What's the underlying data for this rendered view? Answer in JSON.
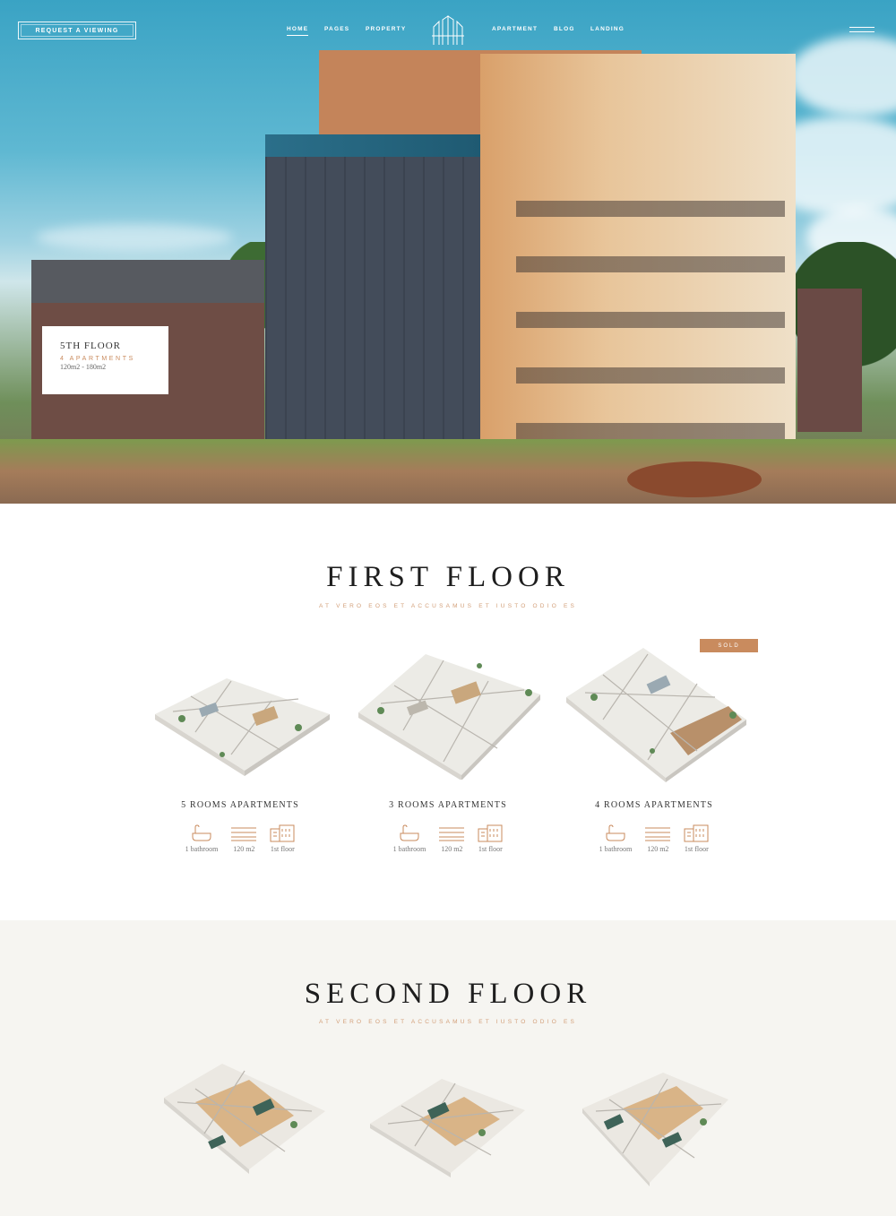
{
  "nav": {
    "cta_label": "REQUEST A VIEWING",
    "menu_items": [
      "HOME",
      "PAGES",
      "PROPERTY",
      "APARTMENT",
      "BLOG",
      "LANDING"
    ],
    "active_item": "HOME"
  },
  "hero": {
    "floor_card": {
      "title": "5TH FLOOR",
      "subtitle": "4 APARTMENTS",
      "meta": "120m2 - 180m2"
    }
  },
  "first_floor": {
    "title": "FIRST FLOOR",
    "subtitle": "AT VERO EOS ET ACCUSAMUS ET IUSTO ODIO ES",
    "apartments": [
      {
        "title": "5 ROOMS APARTMENTS",
        "bathroom": "1 bathroom",
        "area": "120 m2",
        "floor": "1st floor",
        "badge": ""
      },
      {
        "title": "3 ROOMS APARTMENTS",
        "bathroom": "1 bathroom",
        "area": "120 m2",
        "floor": "1st floor",
        "badge": ""
      },
      {
        "title": "4 ROOMS APARTMENTS",
        "bathroom": "1 bathroom",
        "area": "120 m2",
        "floor": "1st floor",
        "badge": "SOLD"
      }
    ]
  },
  "second_floor": {
    "title": "SECOND FLOOR",
    "subtitle": "AT VERO EOS ET ACCUSAMUS ET IUSTO ODIO ES"
  },
  "icons": [
    "logo-icon",
    "hamburger-icon",
    "bathtub-icon",
    "area-icon",
    "building-icon"
  ],
  "colors": {
    "accent": "#c98b5e",
    "subtitle": "#d3a07a",
    "text": "#1e1e1e",
    "section_bg": "#f6f5f1"
  }
}
